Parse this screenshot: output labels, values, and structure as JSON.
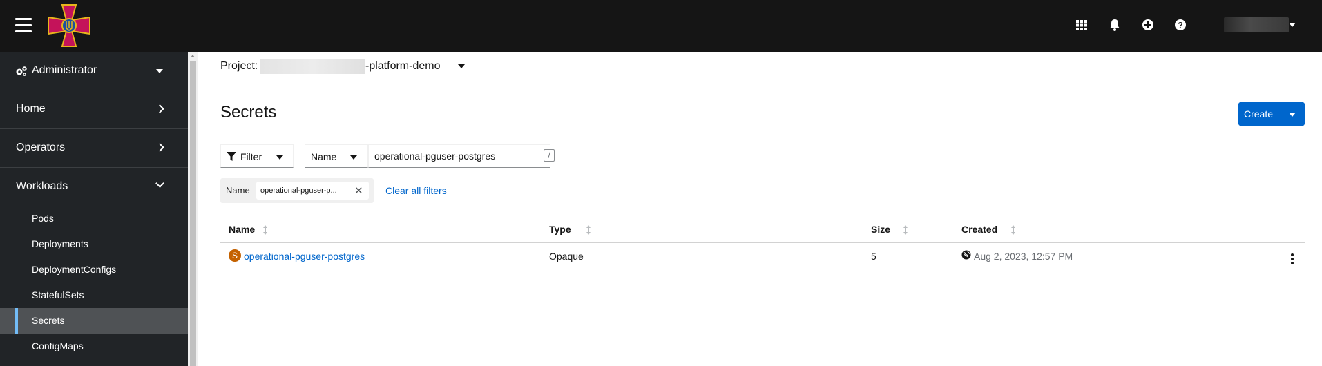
{
  "masthead": {
    "icons": [
      "grid-icon",
      "bell-icon",
      "plus-circle-icon",
      "help-icon"
    ],
    "user_caret": "caret-down-icon"
  },
  "sidebar": {
    "perspective": "Administrator",
    "sections": [
      {
        "label": "Home",
        "expanded": false
      },
      {
        "label": "Operators",
        "expanded": false
      },
      {
        "label": "Workloads",
        "expanded": true
      }
    ],
    "workloads_items": [
      "Pods",
      "Deployments",
      "DeploymentConfigs",
      "StatefulSets",
      "Secrets",
      "ConfigMaps"
    ],
    "active_item": "Secrets"
  },
  "project": {
    "label": "Project:",
    "suffix": "-platform-demo"
  },
  "page": {
    "title": "Secrets",
    "create_label": "Create"
  },
  "filters": {
    "filter_label": "Filter",
    "attribute_label": "Name",
    "search_value": "operational-pguser-postgres",
    "shortcut": "/",
    "chip_category": "Name",
    "chip_value": "operational-pguser-p...",
    "clear_label": "Clear all filters"
  },
  "table": {
    "columns": [
      "Name",
      "Type",
      "Size",
      "Created"
    ],
    "rows": [
      {
        "badge": "S",
        "name": "operational-pguser-postgres",
        "type": "Opaque",
        "size": "5",
        "created": "Aug 2, 2023, 12:57 PM"
      }
    ]
  },
  "colors": {
    "masthead": "#151515",
    "sidebar": "#212427",
    "accent": "#0066cc",
    "badge_secret": "#c46100",
    "active_marker": "#73bcf7"
  }
}
